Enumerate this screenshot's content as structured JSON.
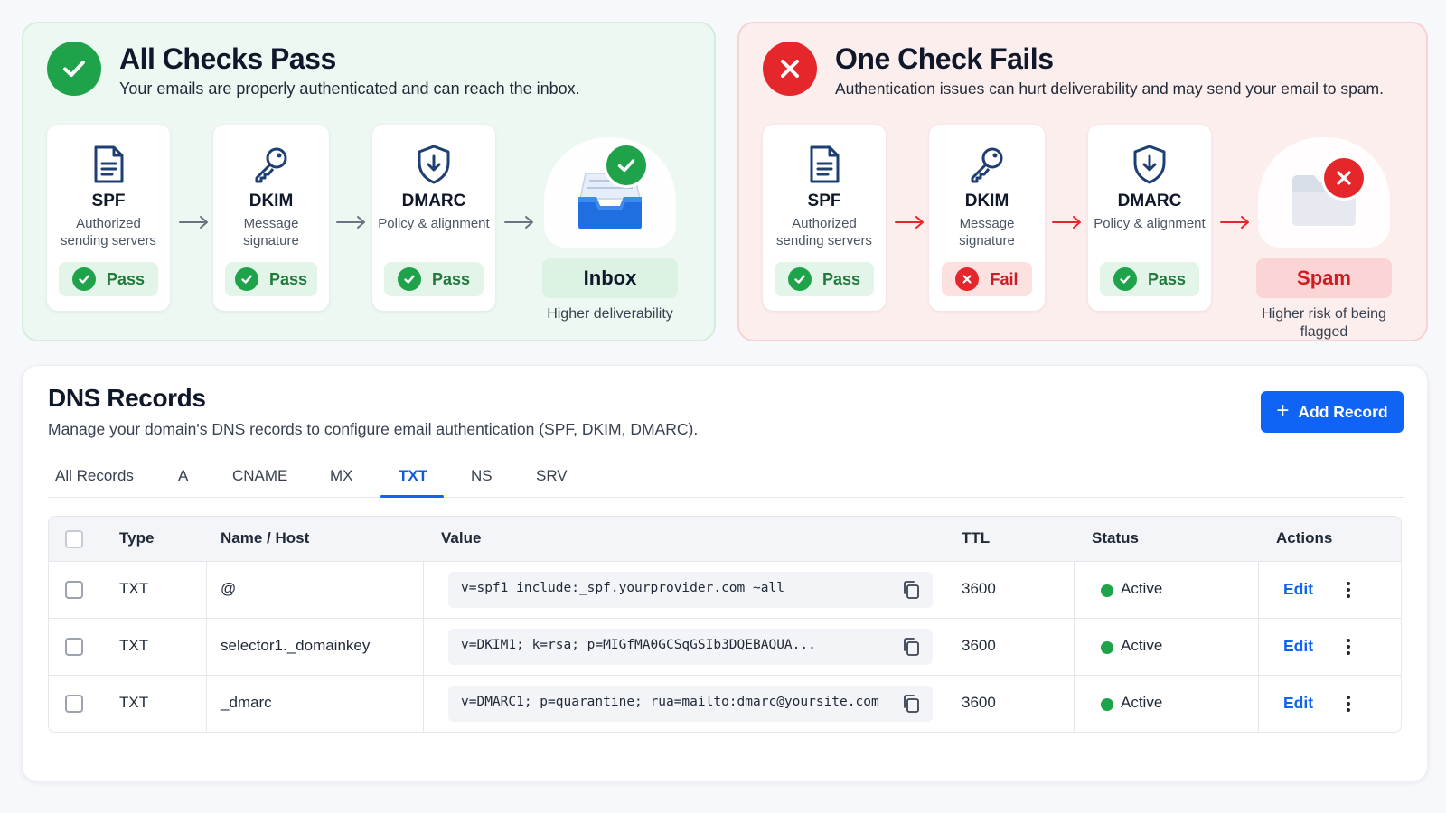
{
  "pass_panel": {
    "title": "All Checks Pass",
    "subtitle": "Your emails are properly authenticated and can reach the inbox.",
    "icon": "check-circle-icon",
    "checks": [
      {
        "name": "SPF",
        "desc1": "Authorized",
        "desc2": "sending servers",
        "status": "Pass",
        "icon": "document-icon"
      },
      {
        "name": "DKIM",
        "desc1": "Message",
        "desc2": "signature",
        "status": "Pass",
        "icon": "key-icon"
      },
      {
        "name": "DMARC",
        "desc1": "Policy & alignment",
        "desc2": "",
        "status": "Pass",
        "icon": "shield-icon"
      }
    ],
    "destination": {
      "label": "Inbox",
      "note": "Higher deliverability",
      "icon": "inbox-tray-icon"
    }
  },
  "fail_panel": {
    "title": "One Check Fails",
    "subtitle": "Authentication issues can hurt deliverability and may send your email to spam.",
    "icon": "x-circle-icon",
    "checks": [
      {
        "name": "SPF",
        "desc1": "Authorized",
        "desc2": "sending servers",
        "status": "Pass",
        "icon": "document-icon"
      },
      {
        "name": "DKIM",
        "desc1": "Message",
        "desc2": "signature",
        "status": "Fail",
        "icon": "key-icon"
      },
      {
        "name": "DMARC",
        "desc1": "Policy & alignment",
        "desc2": "",
        "status": "Pass",
        "icon": "shield-icon"
      }
    ],
    "destination": {
      "label": "Spam",
      "note": "Higher risk of being flagged",
      "icon": "folder-icon"
    }
  },
  "dns": {
    "title": "DNS Records",
    "subtitle": "Manage your domain's DNS records to configure email authentication (SPF, DKIM, DMARC).",
    "add_button": "Add Record",
    "tabs": [
      "All Records",
      "A",
      "CNAME",
      "MX",
      "TXT",
      "NS",
      "SRV"
    ],
    "active_tab": "TXT",
    "columns": [
      "Type",
      "Name / Host",
      "Value",
      "TTL",
      "Status",
      "Actions"
    ],
    "rows": [
      {
        "type": "TXT",
        "name": "@",
        "value": "v=spf1 include:_spf.yourprovider.com ~all",
        "ttl": "3600",
        "status": "Active",
        "action": "Edit"
      },
      {
        "type": "TXT",
        "name": "selector1._domainkey",
        "value": "v=DKIM1; k=rsa; p=MIGfMA0GCSqGSIb3DQEBAQUA...",
        "ttl": "3600",
        "status": "Active",
        "action": "Edit"
      },
      {
        "type": "TXT",
        "name": "_dmarc",
        "value": "v=DMARC1; p=quarantine; rua=mailto:dmarc@yoursite.com",
        "ttl": "3600",
        "status": "Active",
        "action": "Edit"
      }
    ]
  },
  "colors": {
    "pass_green": "#1ea34a",
    "fail_red": "#e5262b",
    "primary_blue": "#0f63f5",
    "active_status": "#1ea34a"
  }
}
